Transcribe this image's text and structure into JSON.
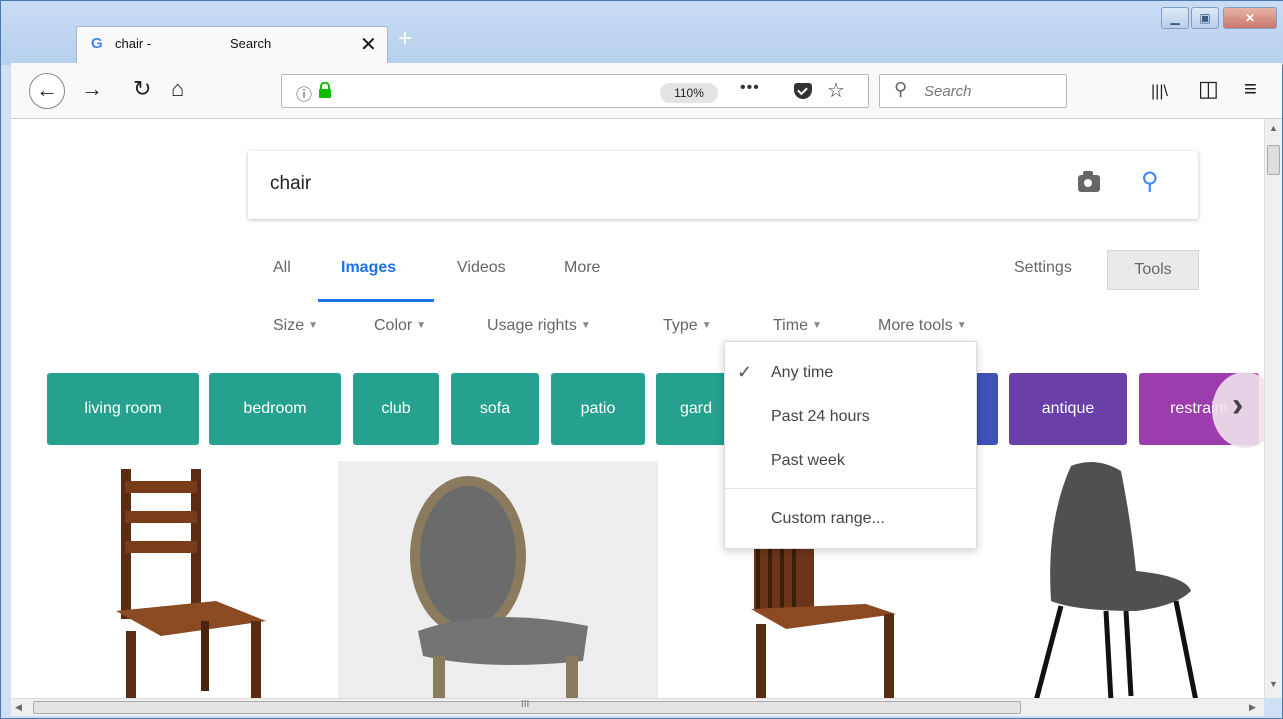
{
  "browser": {
    "tab": {
      "title_a": "chair -",
      "title_b": "Search",
      "close": "✕",
      "favicon": "G"
    },
    "new_tab": "+",
    "window_controls": {
      "minimize": "▁",
      "maximize": "▣",
      "close": "✕"
    },
    "nav": {
      "back": "←",
      "forward": "→",
      "reload": "↻",
      "home": "⌂"
    },
    "urlbar": {
      "info": "ⓘ",
      "zoom": "110%",
      "more": "•••",
      "bookmark": "☆"
    },
    "searchbar": {
      "placeholder": "Search",
      "icon": "⚲"
    },
    "right_icons": {
      "library": "|||\\",
      "sidebar": "◫",
      "menu": "≡"
    }
  },
  "google": {
    "query": "chair",
    "search_icon": "⚲",
    "tabs": [
      "All",
      "Images",
      "Videos",
      "More"
    ],
    "active_tab": "Images",
    "settings": "Settings",
    "tools": "Tools",
    "filters": [
      "Size",
      "Color",
      "Usage rights",
      "Type",
      "Time",
      "More tools"
    ],
    "chips": [
      {
        "label": "living room",
        "color": "#26a08f"
      },
      {
        "label": "bedroom",
        "color": "#26a08f"
      },
      {
        "label": "club",
        "color": "#26a08f"
      },
      {
        "label": "sofa",
        "color": "#26a08f"
      },
      {
        "label": "patio",
        "color": "#26a08f"
      },
      {
        "label": "gard",
        "color": "#26a08f"
      },
      {
        "label": "",
        "color": "#3f51b5"
      },
      {
        "label": "antique",
        "color": "#6a3fa8"
      },
      {
        "label": "restraint",
        "color": "#9c3cad"
      }
    ],
    "chip_next": "›",
    "time_menu": {
      "check": "✓",
      "items": [
        "Any time",
        "Past 24 hours",
        "Past week",
        "Custom range..."
      ],
      "selected": "Any time"
    }
  },
  "scrollbars": {
    "grip": "III",
    "up": "▲",
    "down": "▼",
    "left": "◀",
    "right": "▶"
  }
}
